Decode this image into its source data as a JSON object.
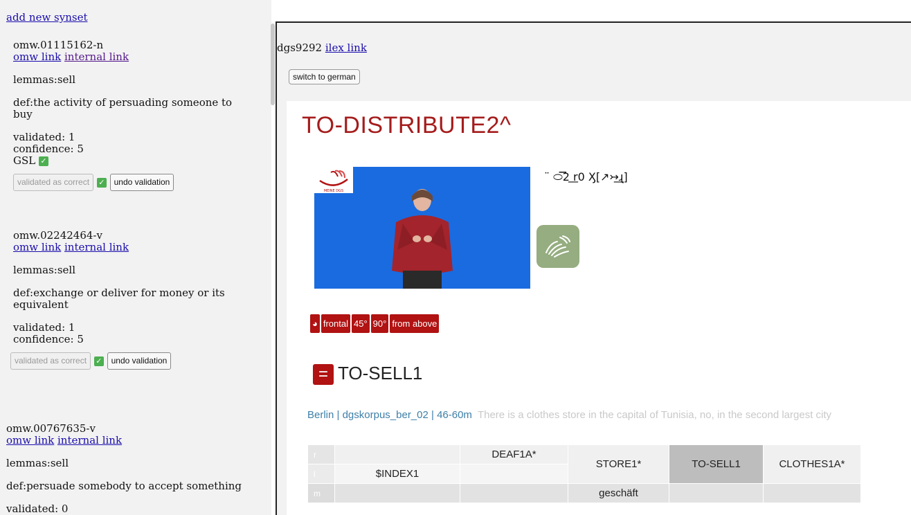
{
  "left": {
    "add_new": "add new synset",
    "synsets": [
      {
        "id": "omw.01115162-n",
        "omw_link": "omw link",
        "internal_link": "internal link",
        "lemmas": "lemmas:sell",
        "def": "def:the activity of persuading someone to buy",
        "validated": "validated: 1",
        "confidence": "confidence: 5",
        "gsl": "GSL",
        "validated_btn": "validated as correct",
        "undo_btn": "undo validation"
      },
      {
        "id": "omw.02242464-v",
        "omw_link": "omw link",
        "internal_link": "internal link",
        "lemmas": "lemmas:sell",
        "def": "def:exchange or deliver for money or its equivalent",
        "validated": "validated: 1",
        "confidence": "confidence: 5",
        "validated_btn": "validated as correct",
        "undo_btn": "undo validation"
      },
      {
        "id": "omw.00767635-v",
        "omw_link": "omw link",
        "internal_link": "internal link",
        "lemmas": "lemmas:sell",
        "def": "def:persuade somebody to accept something",
        "validated": "validated: 0"
      }
    ]
  },
  "right": {
    "id": "dgs9292",
    "ilex_link": "ilex link",
    "switch_btn": "switch to german",
    "title": "TO-DISTRIBUTE2^",
    "logo_text": "MEINE DGS",
    "notation": "̈ ⬭͞2 ͟r0 Ӽ[↗↣͟ɻ]",
    "tags": {
      "frontal": "frontal",
      "deg45": "45°",
      "deg90": "90°",
      "above": "from above"
    },
    "subtitle": "TO-SELL1",
    "context_source": "Berlin | dgskorpus_ber_02 | 46-60m",
    "context_text": "There is a clothes store in the capital of Tunisia, no, in the second largest city",
    "table": {
      "row_labels": [
        "r",
        "l",
        "m"
      ],
      "r": [
        "",
        "DEAF1A*",
        "STORE1*",
        "TO-SELL1",
        "CLOTHES1A*"
      ],
      "l": [
        "$INDEX1"
      ],
      "m": [
        "",
        "",
        "geschäft",
        "",
        ""
      ]
    },
    "colors": {
      "accent": "#b11212",
      "title": "#a51c1c",
      "video_bg": "#1a6be0",
      "handshape_bg": "#95ad80"
    }
  }
}
